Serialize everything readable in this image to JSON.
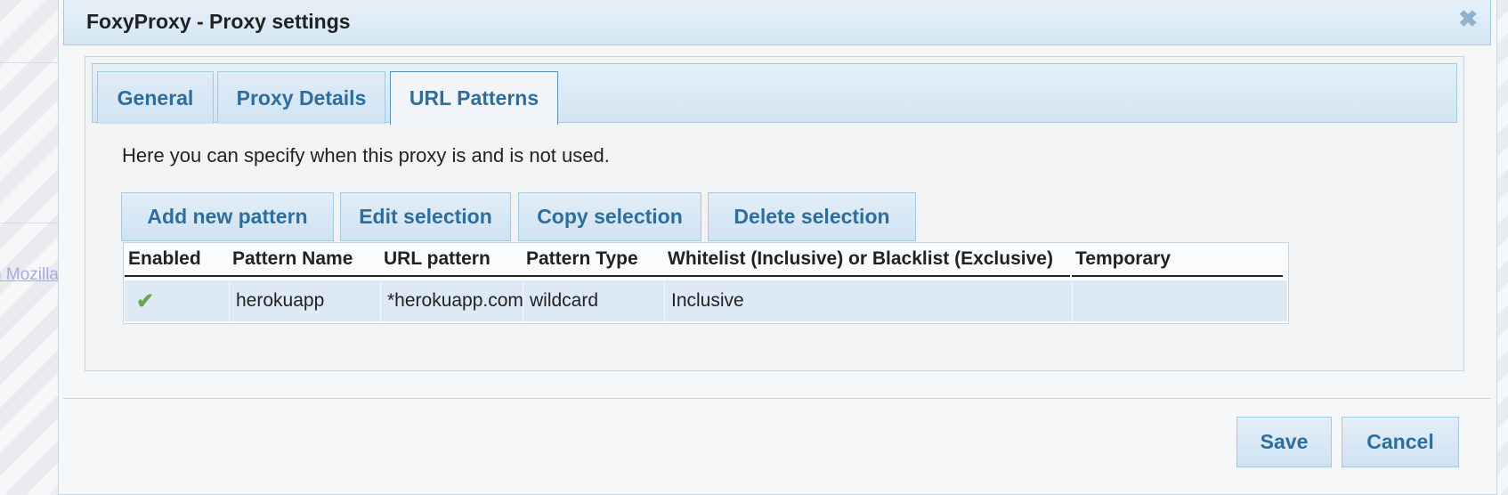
{
  "background": {
    "link_text": "n Mozilla"
  },
  "dialog": {
    "title": "FoxyProxy - Proxy settings",
    "close_icon": "close-icon",
    "tabs": [
      {
        "label": "General",
        "active": false
      },
      {
        "label": "Proxy Details",
        "active": false
      },
      {
        "label": "URL Patterns",
        "active": true
      }
    ],
    "description": "Here you can specify when this proxy is and is not used.",
    "actions": {
      "add": "Add new pattern",
      "edit": "Edit selection",
      "copy": "Copy selection",
      "delete": "Delete selection"
    },
    "table": {
      "columns": [
        "Enabled",
        "Pattern Name",
        "URL pattern",
        "Pattern Type",
        "Whitelist (Inclusive) or Blacklist (Exclusive)",
        "Temporary"
      ],
      "rows": [
        {
          "enabled": "✔",
          "pattern_name": "herokuapp",
          "url_pattern": "*herokuapp.com",
          "pattern_type": "wildcard",
          "list_type": "Inclusive",
          "temporary": ""
        }
      ]
    },
    "footer": {
      "save": "Save",
      "cancel": "Cancel"
    }
  },
  "colors": {
    "accent": "#2e6e9e",
    "header_bg": "#d4e6f4",
    "border": "#a6c9e2",
    "row_highlight": "#dde9f4",
    "check": "#6aa64a"
  }
}
